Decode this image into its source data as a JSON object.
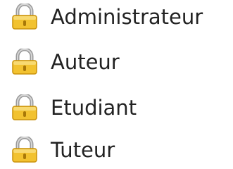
{
  "roles": {
    "items": [
      {
        "label": "Administrateur",
        "icon": "padlock-icon"
      },
      {
        "label": "Auteur",
        "icon": "padlock-icon"
      },
      {
        "label": "Etudiant",
        "icon": "padlock-icon"
      },
      {
        "label": "Tuteur",
        "icon": "padlock-icon"
      }
    ]
  },
  "colors": {
    "lock_body": "#f2c230",
    "lock_body_dark": "#d8a10e",
    "lock_shackle": "#9a9a9a",
    "text": "#222222"
  }
}
